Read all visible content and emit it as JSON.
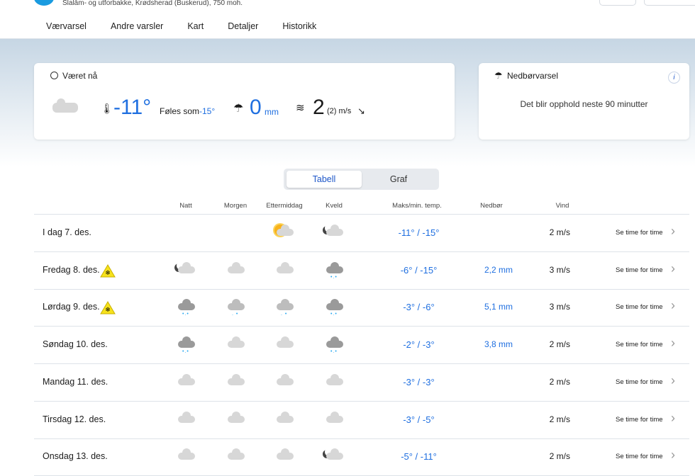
{
  "header": {
    "subtitle": "Slalåm- og utforbakke, Krødsherad (Buskerud), 750 moh."
  },
  "tabs": [
    "Værvarsel",
    "Andre varsler",
    "Kart",
    "Detaljer",
    "Historikk"
  ],
  "now": {
    "title": "Været nå",
    "temp": "-11°",
    "feels_label": "Føles som",
    "feels": "-15°",
    "precip": "0",
    "precip_unit": "mm",
    "wind": "2",
    "gust": "(2) m/s",
    "wind_dir": "↘"
  },
  "precip_card": {
    "title": "Nedbørvarsel",
    "text": "Det blir opphold neste 90 minutter",
    "info": "i"
  },
  "toggle": {
    "table": "Tabell",
    "graph": "Graf"
  },
  "columns": {
    "night": "Natt",
    "morning": "Morgen",
    "afternoon": "Ettermiddag",
    "evening": "Kveld",
    "temp": "Maks/min. temp.",
    "precip": "Nedbør",
    "wind": "Vind"
  },
  "rows": [
    {
      "day": "I dag 7. des.",
      "warn": false,
      "icons": [
        "",
        "",
        "partly-sunny",
        "night-cloudy"
      ],
      "temp": "-11° / -15°",
      "precip": "",
      "wind": "2 m/s",
      "link": "Se time for time"
    },
    {
      "day": "Fredag 8. des.",
      "warn": true,
      "icons": [
        "night-cloudy",
        "cloudy",
        "cloudy",
        "snow"
      ],
      "temp": "-6° / -15°",
      "precip": "2,2 mm",
      "wind": "3 m/s",
      "link": "Se time for time"
    },
    {
      "day": "Lørdag 9. des.",
      "warn": true,
      "icons": [
        "snow",
        "light-snow",
        "light-snow",
        "snow"
      ],
      "temp": "-3° / -6°",
      "precip": "5,1 mm",
      "wind": "3 m/s",
      "link": "Se time for time"
    },
    {
      "day": "Søndag 10. des.",
      "warn": false,
      "icons": [
        "snow",
        "cloudy",
        "cloudy",
        "snow"
      ],
      "temp": "-2° / -3°",
      "precip": "3,8 mm",
      "wind": "2 m/s",
      "link": "Se time for time"
    },
    {
      "day": "Mandag 11. des.",
      "warn": false,
      "icons": [
        "cloudy",
        "cloudy",
        "cloudy",
        "cloudy"
      ],
      "temp": "-3° / -3°",
      "precip": "",
      "wind": "2 m/s",
      "link": "Se time for time"
    },
    {
      "day": "Tirsdag 12. des.",
      "warn": false,
      "icons": [
        "cloudy",
        "cloudy",
        "cloudy",
        "cloudy"
      ],
      "temp": "-3° / -5°",
      "precip": "",
      "wind": "2 m/s",
      "link": "Se time for time"
    },
    {
      "day": "Onsdag 13. des.",
      "warn": false,
      "icons": [
        "cloudy",
        "cloudy",
        "cloudy",
        "night-cloudy"
      ],
      "temp": "-5° / -11°",
      "precip": "",
      "wind": "2 m/s",
      "link": "Se time for time"
    }
  ]
}
